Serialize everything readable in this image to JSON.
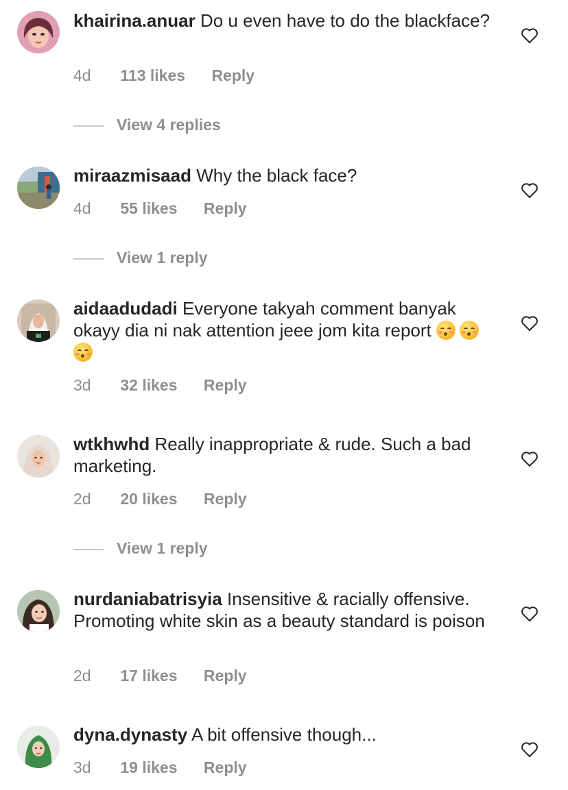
{
  "comments": [
    {
      "username": "khairina.anuar",
      "text": "Do u even have to do the blackface?",
      "time": "4d",
      "likes": "113 likes",
      "reply": "Reply",
      "view_replies": "View 4 replies"
    },
    {
      "username": "miraazmisaad",
      "text": "Why the black face?",
      "time": "4d",
      "likes": "55 likes",
      "reply": "Reply",
      "view_replies": "View 1 reply"
    },
    {
      "username": "aidaadudadi",
      "text": "Everyone takyah comment banyak okayy dia ni nak attention jeee jom kita report",
      "emoji": "kissing-face-with-closed-eyes x3",
      "time": "3d",
      "likes": "32 likes",
      "reply": "Reply"
    },
    {
      "username": "wtkhwhd",
      "text": "Really inappropriate & rude. Such a bad marketing.",
      "time": "2d",
      "likes": "20 likes",
      "reply": "Reply",
      "view_replies": "View 1 reply"
    },
    {
      "username": "nurdaniabatrisyia",
      "text": "Insensitive & racially offensive. Promoting white skin as a beauty standard is poison",
      "time": "2d",
      "likes": "17 likes",
      "reply": "Reply"
    },
    {
      "username": "dyna.dynasty",
      "text": "A bit offensive though...",
      "time": "3d",
      "likes": "19 likes",
      "reply": "Reply"
    }
  ],
  "icons": {
    "like": "heart-outline-icon"
  },
  "colors": {
    "text": "#262626",
    "secondary": "#8e8e8e",
    "divider": "#c7c7c7"
  }
}
